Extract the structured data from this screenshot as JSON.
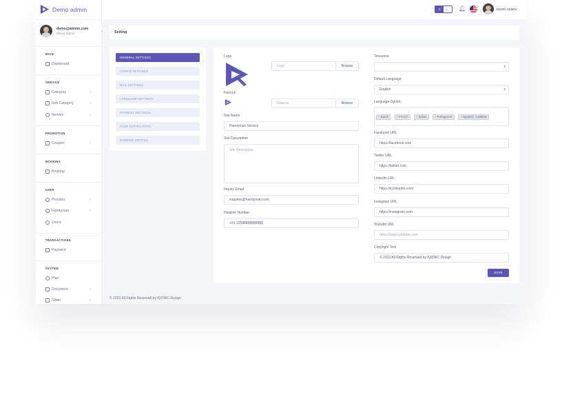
{
  "brand": {
    "name": "Demo admin"
  },
  "user": {
    "email": "demo@admin.com",
    "role": "Demo Admin",
    "top_name": "DEMO ADMIN"
  },
  "sidebar": {
    "sections": [
      {
        "title": "MAIN",
        "items": [
          {
            "label": "Dashboard",
            "icon": "dashboard-icon",
            "chevron": false
          }
        ]
      },
      {
        "title": "SERVICE",
        "items": [
          {
            "label": "Category",
            "icon": "category-icon",
            "chevron": true
          },
          {
            "label": "Sub Category",
            "icon": "sub-category-icon",
            "chevron": true
          },
          {
            "label": "Service",
            "icon": "service-icon",
            "chevron": true
          }
        ]
      },
      {
        "title": "PROMOTION",
        "items": [
          {
            "label": "Coupon",
            "icon": "coupon-icon",
            "chevron": true
          }
        ]
      },
      {
        "title": "BOOKING",
        "items": [
          {
            "label": "Booking",
            "icon": "booking-icon",
            "chevron": false
          }
        ]
      },
      {
        "title": "USER",
        "items": [
          {
            "label": "Provider",
            "icon": "provider-icon",
            "chevron": true
          },
          {
            "label": "Handyman",
            "icon": "handyman-icon",
            "chevron": true
          },
          {
            "label": "Users",
            "icon": "users-icon",
            "chevron": false
          }
        ]
      },
      {
        "title": "TRANSACTIONS",
        "items": [
          {
            "label": "Payment",
            "icon": "payment-icon",
            "chevron": false
          }
        ]
      },
      {
        "title": "SYSTEM",
        "items": [
          {
            "label": "Plan",
            "icon": "plan-icon",
            "chevron": false
          },
          {
            "label": "Document",
            "icon": "document-icon",
            "chevron": true
          },
          {
            "label": "Slider",
            "icon": "slider-icon",
            "chevron": true
          }
        ]
      }
    ]
  },
  "topbar": {
    "icons": [
      "sun-icon",
      "moon-icon",
      "bell-icon",
      "us-flag-icon"
    ]
  },
  "page": {
    "title": "Setting"
  },
  "settings_menu": [
    {
      "label": "GENERAL SETTINGS",
      "active": true
    },
    {
      "label": "CONFIG SETTINGS",
      "active": false
    },
    {
      "label": "MAIL SETTINGS",
      "active": false
    },
    {
      "label": "LANGUAGE SETTINGS",
      "active": false
    },
    {
      "label": "PAYMENT SETTINGS",
      "active": false
    },
    {
      "label": "PUSH NOTIFICATION",
      "active": false
    },
    {
      "label": "EARNING SETTING",
      "active": false
    }
  ],
  "form": {
    "logo_label": "Logo",
    "logo_placeholder": "Logo",
    "favicon_label": "Favicon",
    "favicon_placeholder": "Favicon",
    "browse_label": "Browse",
    "site_name_label": "Site Name",
    "site_name_value": "Handyman Service",
    "site_description_label": "Site Description",
    "site_description_placeholder": "Site Description",
    "inquiry_email_label": "Inquiry Email",
    "inquiry_email_value": "inquiries@handyman.com",
    "helpline_label": "Helpline Number",
    "helpline_value": "+91 12588888888888",
    "timezone_label": "Timezone",
    "timezone_value": "",
    "default_language_label": "Default Language",
    "default_language_value": "English",
    "language_option_label": "Language Option",
    "language_options": [
      "Dutch",
      "French",
      "Italian",
      "Portuguese",
      "Spanish; Castilian"
    ],
    "facebook_label": "Facebook URL",
    "facebook_value": "https://facebook.com",
    "twitter_label": "Twitter URL",
    "twitter_value": "https://twitter.com",
    "linkedin_label": "Linkedin URL",
    "linkedin_value": "https://in.linkedin.com/",
    "instagram_label": "Instagram URL",
    "instagram_value": "https://instagram.com",
    "youtube_label": "Youtube URL",
    "youtube_placeholder": "https://www.youtube.com",
    "copyright_label": "Copyright Text",
    "copyright_value": "© 2023 All Rights Reserved by IQONIC Design",
    "save_label": "SAVE"
  },
  "footer": {
    "text": "© 2023 All Rights Reserved by IQONIC Design"
  },
  "colors": {
    "accent": "#5b56b8",
    "menu_inactive_bg": "#eceef8",
    "background": "#f4f5f9"
  }
}
